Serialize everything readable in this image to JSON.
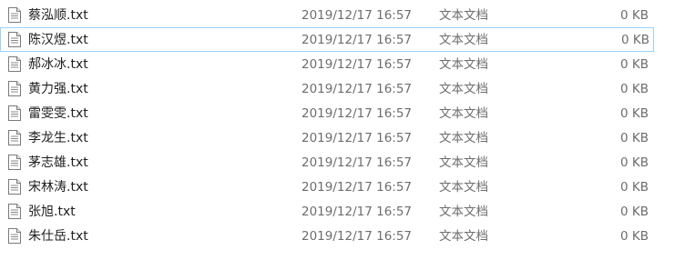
{
  "file_type_icon": "text-document-icon",
  "colors": {
    "selection_border": "#99d1ff",
    "secondary_text": "#6d6d6d"
  },
  "files": [
    {
      "name": "蔡泓顺.txt",
      "modified": "2019/12/17 16:57",
      "type": "文本文档",
      "size": "0 KB"
    },
    {
      "name": "陈汉煜.txt",
      "modified": "2019/12/17 16:57",
      "type": "文本文档",
      "size": "0 KB",
      "selected": true
    },
    {
      "name": "郝冰冰.txt",
      "modified": "2019/12/17 16:57",
      "type": "文本文档",
      "size": "0 KB"
    },
    {
      "name": "黄力强.txt",
      "modified": "2019/12/17 16:57",
      "type": "文本文档",
      "size": "0 KB"
    },
    {
      "name": "雷雯雯.txt",
      "modified": "2019/12/17 16:57",
      "type": "文本文档",
      "size": "0 KB"
    },
    {
      "name": "李龙生.txt",
      "modified": "2019/12/17 16:57",
      "type": "文本文档",
      "size": "0 KB"
    },
    {
      "name": "茅志雄.txt",
      "modified": "2019/12/17 16:57",
      "type": "文本文档",
      "size": "0 KB"
    },
    {
      "name": "宋林涛.txt",
      "modified": "2019/12/17 16:57",
      "type": "文本文档",
      "size": "0 KB"
    },
    {
      "name": "张旭.txt",
      "modified": "2019/12/17 16:57",
      "type": "文本文档",
      "size": "0 KB"
    },
    {
      "name": "朱仕岳.txt",
      "modified": "2019/12/17 16:57",
      "type": "文本文档",
      "size": "0 KB"
    }
  ]
}
